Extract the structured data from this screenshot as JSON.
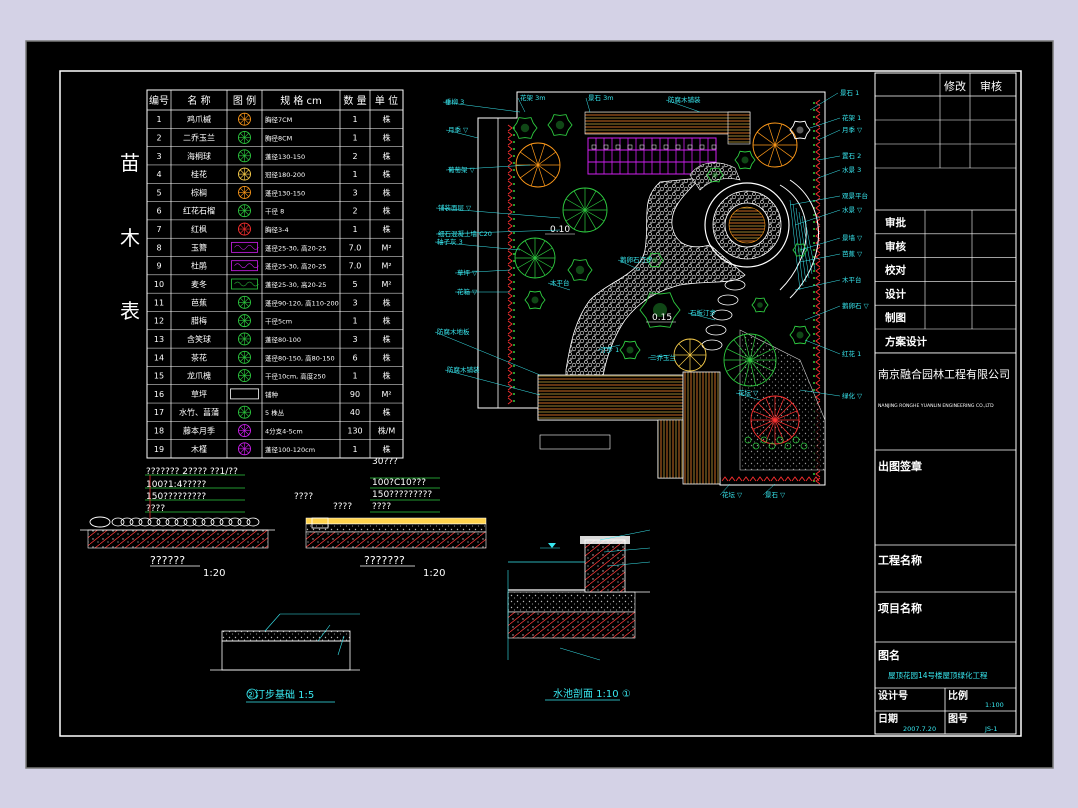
{
  "colors": {
    "background": "#d4d2e6",
    "canvas": "#000000",
    "line": "#ffffff",
    "label": "#38e8f0",
    "plant_green": "#2ecc40",
    "plant_orange": "#ff9a1a",
    "pergola_magenta": "#d020f0",
    "deck_brown": "#c86a22",
    "hedge_red": "#ff3030"
  },
  "plant_table": {
    "side_title": [
      "苗",
      "木",
      "表"
    ],
    "headers": [
      "编号",
      "名 称",
      "图 例",
      "规 格 cm",
      "数 量",
      "单 位"
    ],
    "rows": [
      {
        "no": "1",
        "name": "鸡爪槭",
        "spec": "胸径7CM",
        "qty": "1",
        "unit": "株",
        "icon": "maple-icon"
      },
      {
        "no": "2",
        "name": "二乔玉兰",
        "spec": "胸径8CM",
        "qty": "1",
        "unit": "株",
        "icon": "magnolia-icon"
      },
      {
        "no": "3",
        "name": "海桐球",
        "spec": "蓬径130-150",
        "qty": "2",
        "unit": "株",
        "icon": "shrub-ball-icon"
      },
      {
        "no": "4",
        "name": "桂花",
        "spec": "冠径180-200",
        "qty": "1",
        "unit": "株",
        "icon": "osmanthus-icon"
      },
      {
        "no": "5",
        "name": "棕榈",
        "spec": "蓬径130-150",
        "qty": "3",
        "unit": "株",
        "icon": "palm-icon"
      },
      {
        "no": "6",
        "name": "红花石榴",
        "spec": "干径 8",
        "qty": "2",
        "unit": "株",
        "icon": "pomegranate-icon"
      },
      {
        "no": "7",
        "name": "红枫",
        "spec": "胸径3-4",
        "qty": "1",
        "unit": "株",
        "icon": "red-maple-icon"
      },
      {
        "no": "8",
        "name": "玉簪",
        "spec": "蓬径25-30, 高20-25",
        "qty": "7.0",
        "unit": "M²",
        "icon": "hosta-icon"
      },
      {
        "no": "9",
        "name": "杜鹃",
        "spec": "蓬径25-30, 高20-25",
        "qty": "7.0",
        "unit": "M²",
        "icon": "azalea-icon"
      },
      {
        "no": "10",
        "name": "麦冬",
        "spec": "蓬径25-30, 高20-25",
        "qty": "5",
        "unit": "M²",
        "icon": "ophiopogon-icon"
      },
      {
        "no": "11",
        "name": "芭蕉",
        "spec": "蓬径90-120, 高110-200",
        "qty": "3",
        "unit": "株",
        "icon": "banana-icon"
      },
      {
        "no": "12",
        "name": "腊梅",
        "spec": "干径5cm",
        "qty": "1",
        "unit": "株",
        "icon": "wintersweet-icon"
      },
      {
        "no": "13",
        "name": "含笑球",
        "spec": "蓬径80-100",
        "qty": "3",
        "unit": "株",
        "icon": "michelia-icon"
      },
      {
        "no": "14",
        "name": "茶花",
        "spec": "蓬径80-150, 高80-150",
        "qty": "6",
        "unit": "株",
        "icon": "camellia-icon"
      },
      {
        "no": "15",
        "name": "龙爪槐",
        "spec": "干径10cm, 高度250",
        "qty": "1",
        "unit": "株",
        "icon": "sophora-icon"
      },
      {
        "no": "16",
        "name": "草坪",
        "spec": "铺种",
        "qty": "90",
        "unit": "M²",
        "icon": "lawn-icon"
      },
      {
        "no": "17",
        "name": "水竹、菖蒲",
        "spec": "5 株丛",
        "qty": "40",
        "unit": "株",
        "icon": "water-plant-icon"
      },
      {
        "no": "18",
        "name": "藤本月季",
        "spec": "4分支4-5cm",
        "qty": "130",
        "unit": "株/M",
        "icon": "rose-icon"
      },
      {
        "no": "19",
        "name": "木槿",
        "spec": "蓬径100-120cm",
        "qty": "1",
        "unit": "株",
        "icon": "hibiscus-icon"
      }
    ]
  },
  "sections": {
    "section_a": {
      "notes": [
        "??????? 2???? ??1/??",
        "100?1:4?????",
        "150?????????",
        "????"
      ],
      "title": "??????",
      "scale": "1:20"
    },
    "section_b": {
      "notes": [
        "30???",
        "100?C10???",
        "150?????????",
        "????"
      ],
      "left_note": "????",
      "mid_note": "????",
      "title": "???????",
      "scale": "1:20"
    },
    "stepping_stone": {
      "label": "②汀步基础 1:5"
    },
    "pool_section": {
      "label": "水池剖面 1:10 ①"
    }
  },
  "plan_labels": {
    "left": [
      "垂柳 3",
      "月季 ▽",
      "葡萄架 ▽",
      "铺装面层 ▽",
      "细石混凝土墙 C20",
      "轴子灰 3",
      "草坪 ▽",
      "花箱 ▽",
      "防腐木地板",
      "防腐木铺装"
    ],
    "top": [
      "景石 3m",
      "防腐木铺装",
      "花架 3m"
    ],
    "right": [
      "景石 1",
      "花架 1",
      "月季 ▽",
      "置石 2",
      "水景 3",
      "观景平台",
      "水景 ▽",
      "景墙 ▽",
      "芭蕉 ▽",
      "木平台",
      "鹅卵石 ▽",
      "红花 1",
      "绿化 ▽"
    ],
    "mid": [
      "0.10",
      "0.15",
      "鹅卵石汀步",
      "汀步 1",
      "石板汀步",
      "二乔玉兰",
      "木平台",
      "花坛 ▽"
    ],
    "bottom": [
      "花坛 ▽",
      "景石 ▽"
    ]
  },
  "title_block": {
    "revision_header": [
      "修改",
      "审核"
    ],
    "approval_rows": [
      "审批",
      "审核",
      "校对",
      "设计",
      "制图",
      "方案设计"
    ],
    "company": "南京融合园林工程有限公司",
    "company_en": "NANJING RONGHE YUANLIN ENGINEERING CO.,LTD",
    "seal_label": "出图签章",
    "project_label": "工程名称",
    "item_label": "项目名称",
    "drawing_label": "图名",
    "drawing_name": "屋顶花园14号楼屋顶绿化工程",
    "design_no_label": "设计号",
    "scale_label": "比例",
    "scale_value": "1:100",
    "date_label": "日期",
    "date_value": "2007.7.20",
    "sheet_label": "图号",
    "sheet_value": "JS-1"
  }
}
